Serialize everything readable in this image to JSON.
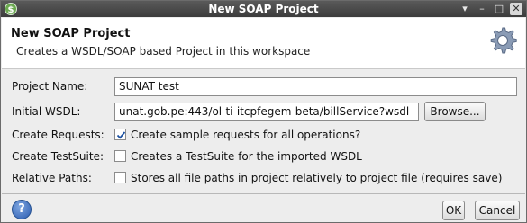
{
  "window": {
    "title": "New SOAP Project",
    "controls": [
      "▾",
      "–",
      "□",
      "✕"
    ]
  },
  "banner": {
    "title": "New SOAP Project",
    "subtitle": "Creates a WSDL/SOAP based Project in this workspace",
    "icon": "gear-icon"
  },
  "form": {
    "project_name": {
      "label": "Project Name:",
      "value": "SUNAT test"
    },
    "initial_wsdl": {
      "label": "Initial WSDL:",
      "value": "unat.gob.pe:443/ol-ti-itcpfegem-beta/billService?wsdl",
      "browse_label": "Browse..."
    },
    "create_requests": {
      "label": "Create Requests:",
      "checked": true,
      "text": "Create sample requests for all operations?"
    },
    "create_testsuite": {
      "label": "Create TestSuite:",
      "checked": false,
      "text": "Creates a TestSuite for the imported WSDL"
    },
    "relative_paths": {
      "label": "Relative Paths:",
      "checked": false,
      "text": "Stores all file paths in project relatively to project file (requires save)"
    }
  },
  "footer": {
    "help_label": "?",
    "ok_label": "OK",
    "cancel_label": "Cancel"
  },
  "colors": {
    "titlebar": "#3c3c3c",
    "banner_bg": "#ffffff",
    "dialog_bg": "#ededed",
    "help_blue": "#2a5bb0"
  }
}
